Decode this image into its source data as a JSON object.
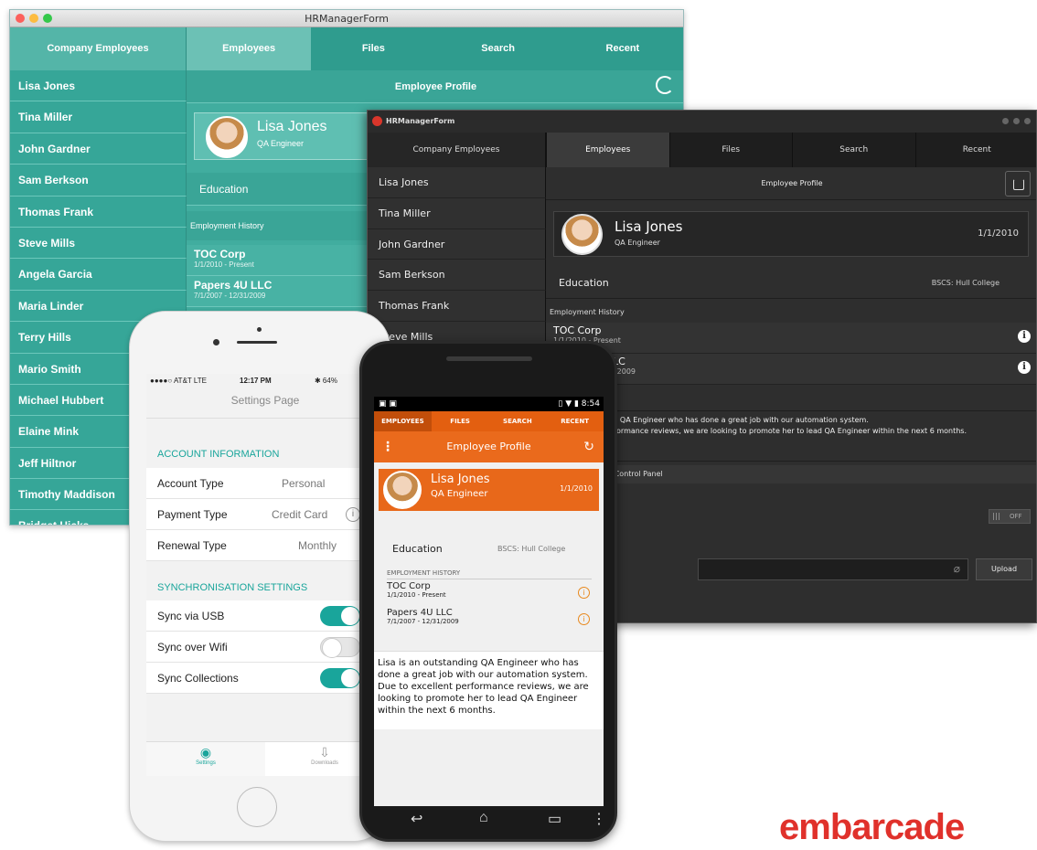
{
  "mac": {
    "title": "HRManagerForm",
    "sidebar_title": "Company Employees",
    "employees": [
      "Lisa Jones",
      "Tina Miller",
      "John Gardner",
      "Sam Berkson",
      "Thomas Frank",
      "Steve Mills",
      "Angela Garcia",
      "Maria Linder",
      "Terry Hills",
      "Mario Smith",
      "Michael Hubbert",
      "Elaine Mink",
      "Jeff Hiltnor",
      "Timothy Maddison",
      "Bridget Hicks"
    ],
    "tabs": [
      "Employees",
      "Files",
      "Search",
      "Recent"
    ],
    "profile_title": "Employee Profile",
    "name": "Lisa Jones",
    "role": "QA Engineer",
    "education": "Education",
    "employment_history": "Employment History",
    "history": [
      {
        "company": "TOC Corp",
        "dates": "1/1/2010 - Present"
      },
      {
        "company": "Papers 4U LLC",
        "dates": "7/1/2007 - 12/31/2009"
      }
    ],
    "colors": {
      "teal": "#3aa89a",
      "teal_light": "#6cc1b5"
    }
  },
  "dark": {
    "title": "HRManagerForm",
    "sidebar_title": "Company Employees",
    "employees": [
      "Lisa Jones",
      "Tina Miller",
      "John Gardner",
      "Sam Berkson",
      "Thomas Frank",
      "Steve Mills"
    ],
    "tabs": [
      "Employees",
      "Files",
      "Search",
      "Recent"
    ],
    "profile_title": "Employee Profile",
    "name": "Lisa Jones",
    "role": "QA Engineer",
    "date": "1/1/2010",
    "education": "Education",
    "education_value": "BSCS: Hull College",
    "employment_history": "Employment History",
    "history": [
      {
        "company": "TOC Corp",
        "dates": "1/1/2010 - Present"
      },
      {
        "company": "Papers 4U LLC",
        "dates": "7/1/2007 - 12/31/2009"
      }
    ],
    "bio_line1": "ing QA Engineer who has done a great job with our automation system.",
    "bio_line2": "erformance reviews, we are looking to promote her to lead QA Engineer within the next 6 months.",
    "control_panel": "s Control Panel",
    "sub_section": "n",
    "toggle_state": "OFF",
    "upload_label": "ad",
    "upload_button": "Upload"
  },
  "iphone": {
    "carrier": "●●●●○ AT&T  LTE",
    "time": "12:17 PM",
    "battery": "✱ 64%",
    "title": "Settings Page",
    "account_section": "ACCOUNT INFORMATION",
    "account_rows": [
      {
        "label": "Account Type",
        "value": "Personal"
      },
      {
        "label": "Payment Type",
        "value": "Credit Card"
      },
      {
        "label": "Renewal Type",
        "value": "Monthly"
      }
    ],
    "sync_section": "SYNCHRONISATION SETTINGS",
    "sync_rows": [
      {
        "label": "Sync via USB",
        "on": true
      },
      {
        "label": "Sync over Wifi",
        "on": false
      },
      {
        "label": "Sync Collections",
        "on": true
      }
    ],
    "tab_settings": "Settings",
    "tab_downloads": "Downloads",
    "accent": "#19a59b"
  },
  "android": {
    "status_left": "▣ ▣",
    "status_right": "▯ ▼ ▮ 8:54",
    "tabs": [
      "EMPLOYEES",
      "FILES",
      "SEARCH",
      "RECENT"
    ],
    "title": "Employee Profile",
    "name": "Lisa Jones",
    "role": "QA Engineer",
    "date": "1/1/2010",
    "education": "Education",
    "education_value": "BSCS: Hull College",
    "employment_history": "EMPLOYMENT HISTORY",
    "history": [
      {
        "company": "TOC Corp",
        "dates": "1/1/2010 - Present"
      },
      {
        "company": "Papers 4U LLC",
        "dates": "7/1/2007 - 12/31/2009"
      }
    ],
    "bio": "Lisa is an outstanding QA Engineer who has done a great job with our automation system. Due to excellent performance reviews, we are looking to promote her to lead QA Engineer within the next 6 months.",
    "accent": "#e8681a"
  },
  "brand": {
    "logo_text": "embarcade",
    "color": "#e0312b"
  }
}
